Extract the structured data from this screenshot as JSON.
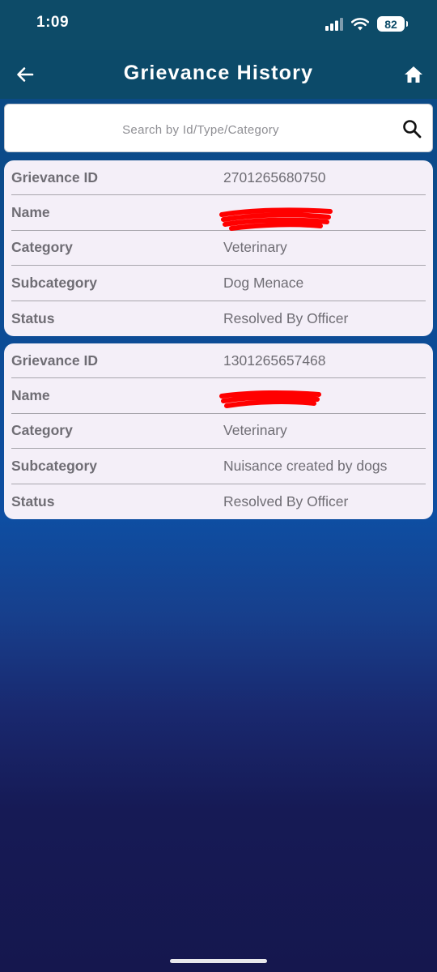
{
  "status_bar": {
    "time": "1:09",
    "battery": "82",
    "icons": [
      "signal-icon",
      "wifi-icon",
      "battery-icon"
    ]
  },
  "app_bar": {
    "title": "Grievance History",
    "back_icon": "back-arrow-icon",
    "home_icon": "home-icon"
  },
  "search": {
    "placeholder": "Search by Id/Type/Category",
    "value": "",
    "icon": "search-icon"
  },
  "labels": {
    "id": "Grievance ID",
    "name": "Name",
    "category": "Category",
    "subcategory": "Subcategory",
    "status": "Status"
  },
  "grievances": [
    {
      "id": "2701265680750",
      "category": "Veterinary",
      "subcategory": "Dog Menace",
      "status": "Resolved By Officer"
    },
    {
      "id": "1301265657468",
      "category": "Veterinary",
      "subcategory": "Nuisance created by dogs",
      "status": "Resolved By Officer"
    }
  ],
  "colors": {
    "app_bar": "#0c4a69",
    "card_background": "#f4eff8",
    "text": "#6f6d74",
    "redaction": "#ff0000"
  }
}
